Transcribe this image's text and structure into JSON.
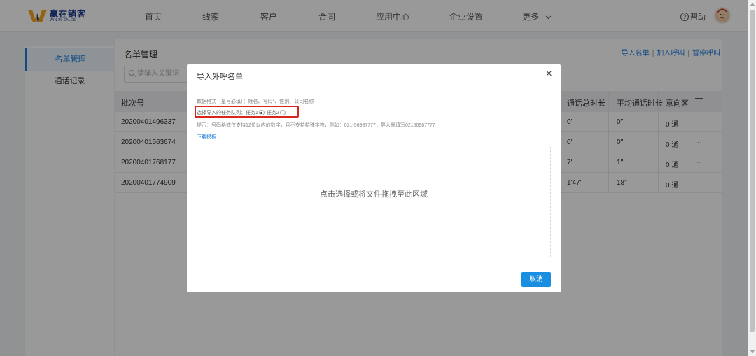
{
  "brand": {
    "name_cn": "赢在销客",
    "name_en": "WIN IN SALES"
  },
  "nav": {
    "items": [
      "首页",
      "线索",
      "客户",
      "合同",
      "应用中心",
      "企业设置",
      "更多"
    ],
    "help_label": "帮助"
  },
  "sidebar": {
    "items": [
      {
        "label": "名单管理",
        "active": true
      },
      {
        "label": "通话记录",
        "active": false
      }
    ]
  },
  "page": {
    "title": "名单管理",
    "links": [
      "导入名单",
      "加入呼叫",
      "暂停呼叫"
    ],
    "search_placeholder": "请输入关键词"
  },
  "table": {
    "headers": [
      "批次号",
      "通话总时长",
      "平均通话时长",
      "意向客"
    ],
    "rows": [
      {
        "batch": "20200401496337",
        "total": "0''",
        "avg": "0''",
        "intent": "0 通",
        "more": "···"
      },
      {
        "batch": "20200401563674",
        "total": "0''",
        "avg": "0''",
        "intent": "0 通",
        "more": "···"
      },
      {
        "batch": "20200401768177",
        "total": "7''",
        "avg": "1''",
        "intent": "0 通",
        "more": "···"
      },
      {
        "batch": "20200401774909",
        "total": "1'47''",
        "avg": "18''",
        "intent": "0 通",
        "more": "···"
      }
    ]
  },
  "modal": {
    "title": "导入外呼名单",
    "close": "×",
    "format_line": "数据格式（星号必填）：姓名、号码*、性别、公司名称",
    "queue_label": "选择导入的任务队列：",
    "queue_options": [
      "任务1",
      "任务2"
    ],
    "queue_selected": 0,
    "tip_line": "提示：号码格式仅支持12位以内的数字，且不支持特殊字符，例如：021-56987777，导入需填写02156987777",
    "download_link": "下载模板",
    "dropzone_text": "点击选择或将文件拖拽至此区域",
    "cancel_button": "取消"
  },
  "colors": {
    "accent": "#1a8ee1",
    "link": "#1a7cde",
    "highlight_box": "#d9261c",
    "overlay": "rgba(0,0,0,0.4)"
  },
  "icons": [
    "logo-icon",
    "help-icon",
    "chevron-down-icon",
    "search-icon",
    "list-icon",
    "close-icon",
    "radio-icon"
  ]
}
